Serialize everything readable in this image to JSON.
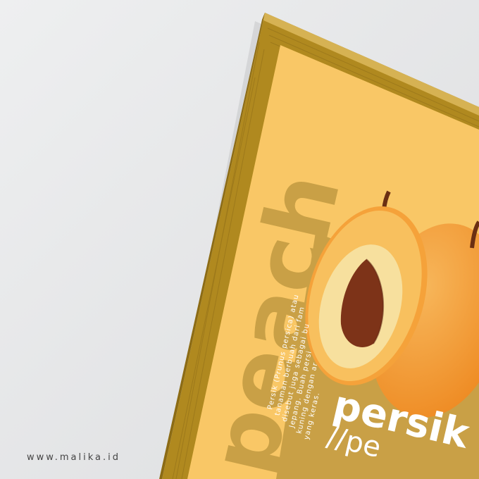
{
  "poster": {
    "vertical_word": "peach",
    "title": "persik",
    "pronunciation": "//pe",
    "description_lines": [
      "Persik (Prunus persica) atau",
      "tanaman berbuah dari fam",
      "disebut juga sebagai bu",
      "Jepang. Buah persi",
      "kuning dengan ar",
      "yang keras."
    ]
  },
  "watermark": "www.malika.id",
  "colors": {
    "background": "#e6e7e8",
    "frame_wood": "#b8922c",
    "poster_yellow": "#f9c766",
    "panel_mustard": "#c9a046",
    "peach_orange": "#f39d3a",
    "pit_brown": "#7d3318"
  }
}
